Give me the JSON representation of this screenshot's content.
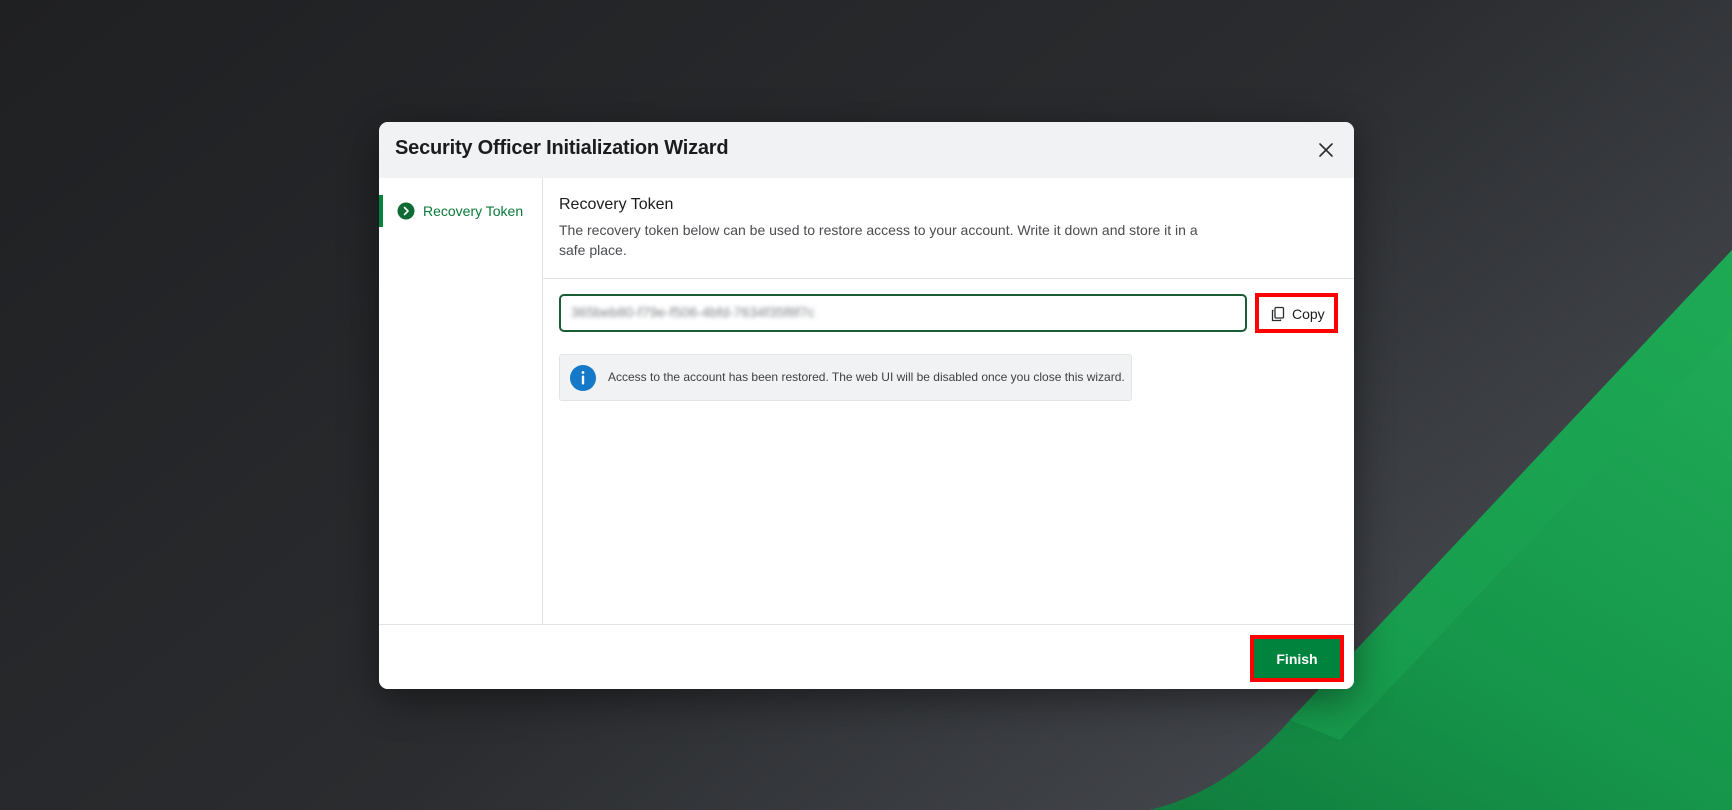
{
  "colors": {
    "brand_green": "#00843d",
    "highlight_red": "#ff0000",
    "info_blue": "#1479c8",
    "input_border": "#1a5c34"
  },
  "modal": {
    "title": "Security Officer Initialization Wizard",
    "close_icon": "close-icon"
  },
  "sidebar": {
    "steps": [
      {
        "label": "Recovery Token",
        "icon": "chevron-right-circle-icon",
        "active": true
      }
    ]
  },
  "content": {
    "section_title": "Recovery Token",
    "description": "The recovery token below can be used to restore access to your account. Write it down and store it in a safe place.",
    "token_value": "365beb80-f79e-f506-4bfd-7634f35f8f7c",
    "copy_label": "Copy",
    "copy_icon": "copy-icon",
    "info_icon": "info-icon",
    "info_text": "Access to the account has been restored. The web UI will be disabled once you close this wizard."
  },
  "footer": {
    "finish_label": "Finish"
  }
}
